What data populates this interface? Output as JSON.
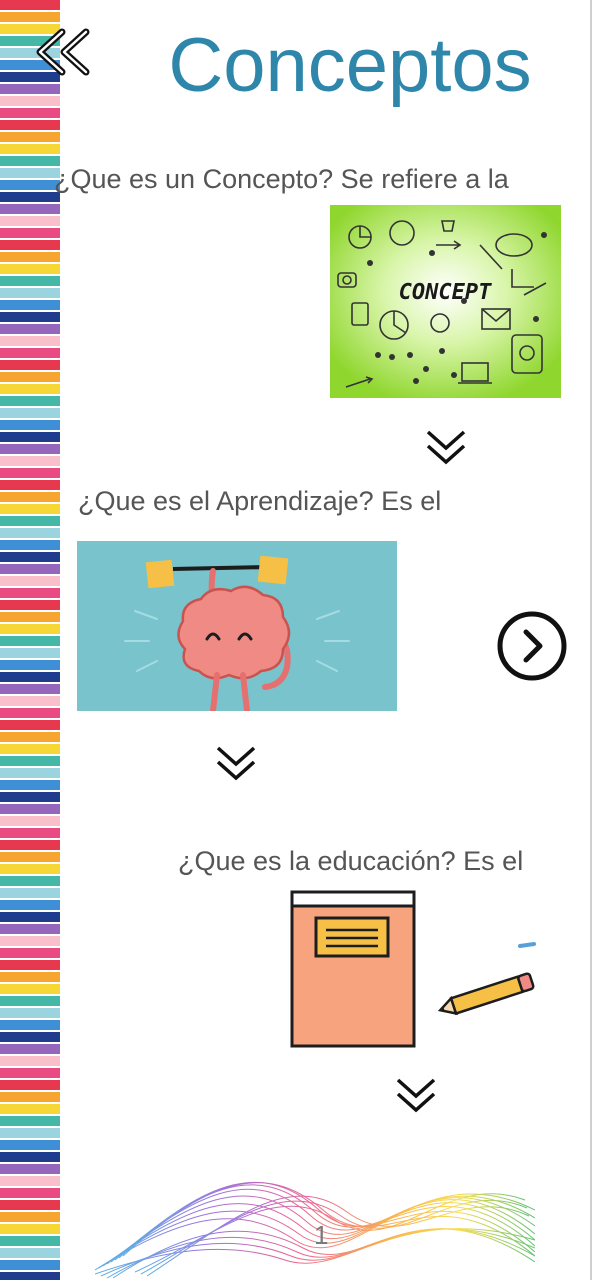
{
  "header": {
    "title": "Conceptos",
    "back_icon": "double-chevron-left-icon"
  },
  "sections": [
    {
      "question": "¿Que es un Concepto? Se refiere a la",
      "image_text": "CONCEPT",
      "expand_icon": "double-chevron-down-icon"
    },
    {
      "question": "¿Que es el Aprendizaje? Es el",
      "expand_icon": "double-chevron-down-icon"
    },
    {
      "question": "¿Que es la educación? Es el",
      "expand_icon": "double-chevron-down-icon"
    }
  ],
  "next_icon": "chevron-right-circle-icon",
  "footer": {
    "page_number": "1"
  },
  "colors": {
    "title": "#2e86ab",
    "text": "#555555",
    "concept_bg": "#a6e34a",
    "brain_bg": "#79c3cd"
  }
}
